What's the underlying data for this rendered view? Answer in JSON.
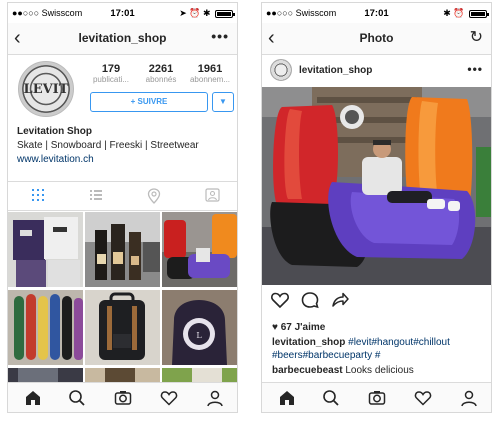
{
  "status": {
    "carrier": "●●○○○ Swisscom",
    "time": "17:01"
  },
  "profile": {
    "title": "levitation_shop",
    "more": "•••",
    "avatar_text": "LEVIT",
    "stats": [
      {
        "num": "179",
        "label": "publicati..."
      },
      {
        "num": "2261",
        "label": "abonnés"
      },
      {
        "num": "1961",
        "label": "abonnem..."
      }
    ],
    "follow_label": "+ SUIVRE",
    "dropdown_label": "▼",
    "bio_name": "Levitation Shop",
    "bio_text": "Skate | Snowboard | Freeski | Streetwear",
    "bio_link": "www.levitation.ch",
    "view_tabs": [
      "grid-view",
      "list-view",
      "location-view",
      "tagged-view"
    ]
  },
  "post": {
    "title": "Photo",
    "username": "levitation_shop",
    "more": "•••",
    "likes": "♥ 67 J'aime",
    "caption_user": "levitation_shop",
    "caption_tags": "#levit#hangout#chillout #beers#barbecueparty #",
    "comment_user": "barbecuebeast",
    "comment_text": "Looks delicious"
  },
  "tabbar": [
    "home",
    "search",
    "camera",
    "activity",
    "profile"
  ],
  "colors": {
    "accent": "#3897f0",
    "link": "#003569",
    "text": "#262626"
  }
}
